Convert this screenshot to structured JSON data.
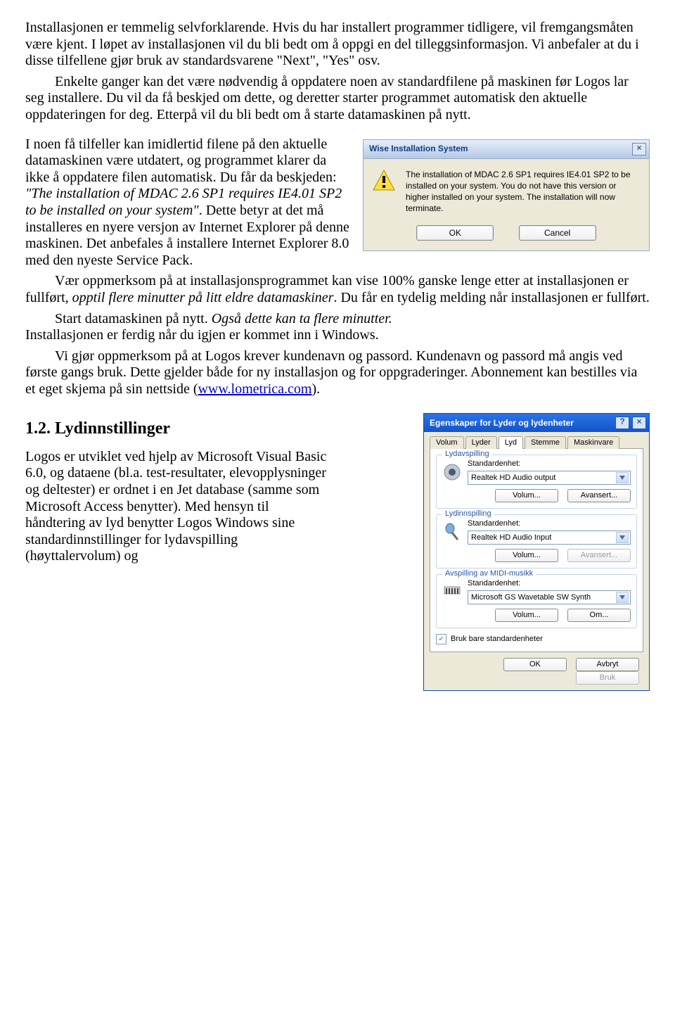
{
  "para1": "Installasjonen er temmelig selvforklarende. Hvis du har installert programmer tidligere, vil fremgangsmåten være kjent. I løpet av installasjonen vil du bli bedt om å oppgi en del tilleggsinformasjon. Vi anbefaler at du i disse tilfellene gjør bruk av standardsvarene \"Next\", \"Yes\" osv.",
  "para1b": "Enkelte ganger kan det være nødvendig å oppdatere noen av standardfilene på maskinen før Logos lar seg installere. Du vil da få beskjed om dette, og deretter starter programmet automatisk den aktuelle oppdateringen for deg. Etterpå vil du bli bedt om å starte datamaskinen på nytt.",
  "para2_a": "I noen få tilfeller kan imidlertid filene på den aktuelle datamaskinen være utdatert, og programmet klarer da ikke å oppdatere filen automatisk. Du får da beskjeden: ",
  "para2_quote": "\"The installation of MDAC 2.6 SP1 requires IE4.01 SP2 to be installed on your system\"",
  "para2_b": ". Dette betyr at det må installeres en nyere versjon av Internet Explorer på denne maskinen. Det anbefales å installere Internet Explorer 8.0 med den nyeste Service Pack.",
  "para3": "Vær oppmerksom på at installasjonsprogrammet kan vise 100% ganske lenge etter at installasjonen er fullført, ",
  "para3_i": "opptil flere minutter på litt eldre datamaskiner",
  "para3_c": ". Du får en tydelig melding når installasjonen er fullført.",
  "para4a": "Start datamaskinen på nytt. ",
  "para4i": "Også dette kan ta flere minutter.",
  "para5": "Installasjonen er ferdig når du igjen er kommet inn i Windows.",
  "para6_a": "Vi gjør oppmerksom på at Logos krever kundenavn og passord. Kundenavn og passord må angis ved første gangs bruk. Dette gjelder både for ny installasjon og for oppgraderinger. Abonnement kan bestilles via et eget skjema på  sin nettside (",
  "link": "www.lometrica.com",
  "para6_b": ").",
  "heading": "1.2.  Lydinnstillinger",
  "para7": "Logos er utviklet ved hjelp av Microsoft Visual Basic 6.0, og dataene (bl.a. test-resultater, elevopplysninger og deltester) er ordnet i en Jet database (samme som Microsoft Access benytter). Med hensyn til håndtering av lyd benytter Logos Windows sine standardinnstillinger for lydavspilling (høyttalervolum) og",
  "wise": {
    "title": "Wise Installation System",
    "msg": "The installation of MDAC 2.6 SP1 requires IE4.01 SP2 to be installed  on your system. You do not have this version or higher installed on your system. The installation will now terminate.",
    "ok": "OK",
    "cancel": "Cancel"
  },
  "sound": {
    "title": "Egenskaper for Lyder og lydenheter",
    "tabs": {
      "t1": "Volum",
      "t2": "Lyder",
      "t3": "Lyd",
      "t4": "Stemme",
      "t5": "Maskinvare"
    },
    "g1": {
      "title": "Lydavspilling",
      "label": "Standardenhet:",
      "value": "Realtek HD Audio output",
      "b1": "Volum...",
      "b2": "Avansert..."
    },
    "g2": {
      "title": "Lydinnspilling",
      "label": "Standardenhet:",
      "value": "Realtek HD Audio Input",
      "b1": "Volum...",
      "b2": "Avansert..."
    },
    "g3": {
      "title": "Avspilling av MIDI-musikk",
      "label": "Standardenhet:",
      "value": "Microsoft GS Wavetable SW Synth",
      "b1": "Volum...",
      "b2": "Om..."
    },
    "chk": "Bruk bare standardenheter",
    "ok": "OK",
    "cancel": "Avbryt",
    "apply": "Bruk"
  }
}
